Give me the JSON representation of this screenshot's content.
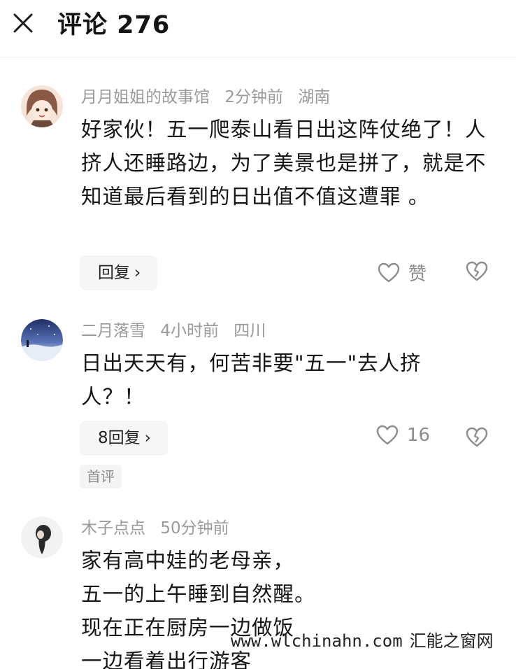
{
  "header": {
    "title": "评论 276"
  },
  "comments": [
    {
      "username": "月月姐姐的故事馆",
      "time": "2分钟前",
      "location": "湖南",
      "text": "好家伙！五一爬泰山看日出这阵仗绝了！人挤人还睡路边，为了美景也是拼了，就是不知道最后看到的日出值不值这遭罪 。",
      "reply_label": "回复",
      "like_label": "赞",
      "avatar_colors": [
        "#f3d9cf",
        "#8a5a44"
      ]
    },
    {
      "username": "二月落雪",
      "time": "4小时前",
      "location": "四川",
      "text": "日出天天有，何苦非要\"五一\"去人挤人？！",
      "reply_label": "8回复",
      "like_label": "16",
      "badge": "首评",
      "avatar_colors": [
        "#2a3d74",
        "#dbe6f6"
      ]
    },
    {
      "username": "木子点点",
      "time": "50分钟前",
      "text": "家有高中娃的老母亲，\n五一的上午睡到自然醒。\n现在正在厨房一边做饭\n一边看着出行游客",
      "avatar_colors": [
        "#f0f0f0",
        "#2a2a2a"
      ]
    }
  ],
  "watermark": {
    "url": "www.wlchinahn.com",
    "name": "汇能之窗网"
  },
  "icons": {
    "close": "close-icon",
    "chevron": "chevron-right-icon",
    "like": "heart-outline-icon",
    "dislike": "broken-heart-icon"
  }
}
